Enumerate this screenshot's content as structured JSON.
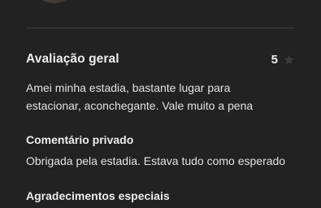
{
  "overall_rating": {
    "title": "Avaliação geral",
    "value": "5",
    "icon": "star-icon"
  },
  "review": {
    "text": "Amei minha estadia, bastante lugar para estacionar, aconchegante. Vale muito a pena"
  },
  "private_comment": {
    "title": "Comentário privado",
    "text": "Obrigada pela estadia. Estava tudo como esperado"
  },
  "special_thanks": {
    "title": "Agradecimentos especiais"
  },
  "colors": {
    "background": "#222222",
    "text": "#e6e6e6",
    "divider": "#3c3c3c",
    "star": "#3a3a3a"
  }
}
